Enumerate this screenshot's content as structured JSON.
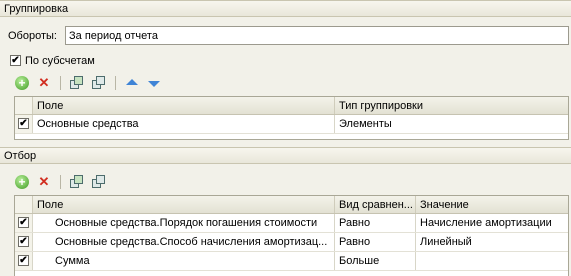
{
  "grouping": {
    "section_title": "Группировка",
    "turnovers_label": "Обороты:",
    "turnovers_value": "За период отчета",
    "by_subaccounts_label": "По субсчетам",
    "by_subaccounts_checked": "✔",
    "toolbar": {
      "add_icon": "plus-icon",
      "delete_icon": "x-icon",
      "check_all_icon": "check-all-icon",
      "uncheck_all_icon": "uncheck-all-icon",
      "move_up_icon": "arrow-up-icon",
      "move_down_icon": "arrow-down-icon"
    },
    "columns": [
      "Поле",
      "Тип группировки"
    ],
    "rows": [
      {
        "checked": "✔",
        "field": "Основные средства",
        "type": "Элементы"
      }
    ]
  },
  "filter": {
    "section_title": "Отбор",
    "toolbar": {
      "add_icon": "plus-icon",
      "delete_icon": "x-icon",
      "check_all_icon": "check-all-icon",
      "uncheck_all_icon": "uncheck-all-icon"
    },
    "columns": [
      "Поле",
      "Вид сравнен...",
      "Значение"
    ],
    "rows": [
      {
        "checked": "✔",
        "field": "Основные средства.Порядок погашения стоимости",
        "comparison": "Равно",
        "value": "Начисление амортизации"
      },
      {
        "checked": "✔",
        "field": "Основные средства.Способ начисления амортизац...",
        "comparison": "Равно",
        "value": "Линейный"
      },
      {
        "checked": "✔",
        "field": "Сумма",
        "comparison": "Больше",
        "value": ""
      }
    ]
  },
  "colors": {
    "background": "#f2f1e9",
    "add_green": "#3e9a23",
    "delete_red": "#d12c1e",
    "arrow_blue": "#3f84d6"
  }
}
